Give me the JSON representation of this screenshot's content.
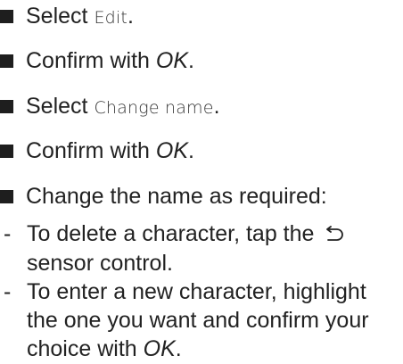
{
  "steps": [
    {
      "verb": "Select",
      "term": "Edit",
      "end": "."
    },
    {
      "verb": "Confirm with",
      "term": "OK",
      "end": "."
    },
    {
      "verb": "Select",
      "term": "Change name",
      "end": "."
    },
    {
      "verb": "Confirm with",
      "term": "OK",
      "end": "."
    },
    {
      "text": "Change the name as required:"
    }
  ],
  "substeps": [
    {
      "text_before": "To delete a character, tap the",
      "icon": "back-arrow-icon",
      "text_after": "sensor control."
    },
    {
      "text_before": "To enter a new character, highlight the one you want and confirm your choice with",
      "term": "OK",
      "end": "."
    }
  ],
  "dash": "-"
}
